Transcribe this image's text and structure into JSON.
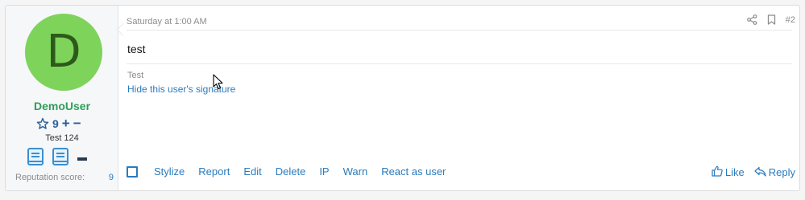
{
  "post": {
    "user": {
      "avatar_letter": "D",
      "avatar_color": "#7ed35b",
      "username": "DemoUser",
      "username_color": "#2e9e57",
      "reputation_count": "9",
      "reputation_plus": "+",
      "reputation_minus": "−",
      "user_title": "Test 124",
      "reputation_score_label": "Reputation score:",
      "reputation_score_value": "9"
    },
    "date": "Saturday at 1:00 AM",
    "post_number": "#2",
    "message": "test",
    "signature": "Test",
    "hide_signature_label": "Hide this user's signature",
    "actions": [
      "Stylize",
      "Report",
      "Edit",
      "Delete",
      "IP",
      "Warn",
      "React as user"
    ],
    "like_label": "Like",
    "reply_label": "Reply"
  },
  "colors": {
    "link": "#2a7bbd",
    "muted": "#8c8c8c"
  }
}
